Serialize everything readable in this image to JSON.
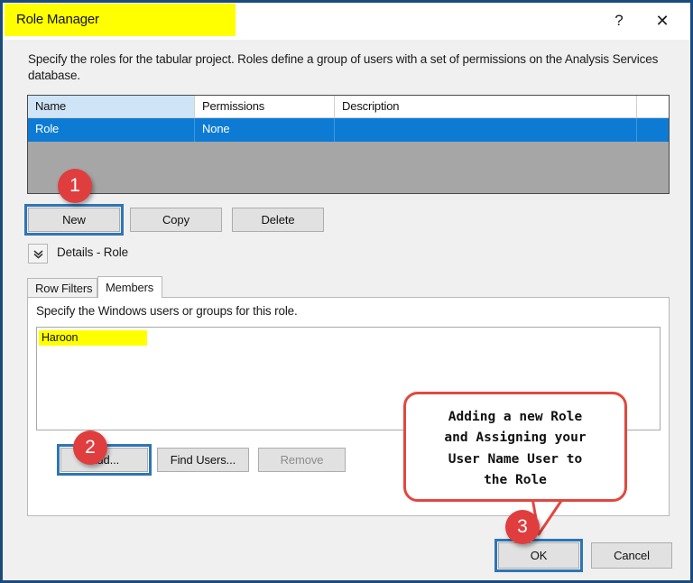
{
  "window": {
    "title": "Role Manager",
    "title_highlight_color": "#ffff00",
    "help_icon": "question-mark-icon",
    "help_label": "?",
    "close_icon": "close-icon",
    "close_label": "✕",
    "border_color": "#1b4b7d"
  },
  "intro": {
    "text": "Specify the roles for the tabular project. Roles define a group of users with a set of permissions on the Analysis Services database."
  },
  "roles_grid": {
    "columns": [
      "Name",
      "Permissions",
      "Description",
      ""
    ],
    "rows": [
      {
        "name": "Role",
        "permissions": "None",
        "description": "",
        "extra": "",
        "selected": true
      }
    ],
    "selection_color": "#0d7bd4",
    "header_highlight_color": "#cfe4f7",
    "empty_area_color": "#a6a6a6"
  },
  "role_buttons": {
    "new": "New",
    "copy": "Copy",
    "delete": "Delete"
  },
  "details": {
    "expander_icon": "chevron-double-down-icon",
    "label": "Details - Role"
  },
  "tabs": [
    {
      "label": "Row Filters",
      "active": false
    },
    {
      "label": "Members",
      "active": true
    }
  ],
  "members_panel": {
    "hint": "Specify the Windows users or groups for this role.",
    "items": [
      {
        "name": "Haroon",
        "highlight_color": "#ffff00"
      }
    ],
    "buttons": {
      "add": "Add...",
      "find_users": "Find Users...",
      "remove": "Remove",
      "remove_disabled": true
    }
  },
  "dialog_buttons": {
    "ok": "OK",
    "cancel": "Cancel"
  },
  "annotations": {
    "accent_color": "#e03e3e",
    "focus_box_color": "#2e75b6",
    "badges": [
      {
        "number": "1",
        "target": "new-button"
      },
      {
        "number": "2",
        "target": "add-button"
      },
      {
        "number": "3",
        "target": "ok-button"
      }
    ],
    "callout": {
      "text": "Adding a new Role\nand Assigning your\nUser Name User to\nthe Role",
      "border_color": "#e1483f"
    }
  }
}
